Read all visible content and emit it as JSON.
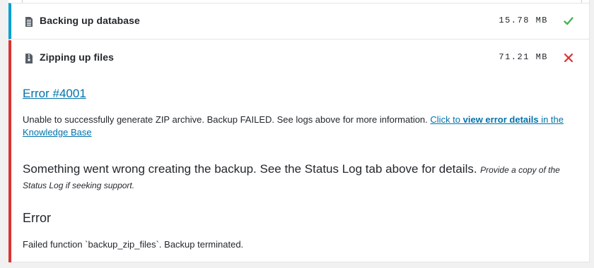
{
  "steps": [
    {
      "title": "Backing up database",
      "size": "15.78 MB",
      "status": "success",
      "icon": "database-file-icon",
      "accent_color": "#00a0d2",
      "status_color": "#46b450"
    },
    {
      "title": "Zipping up files",
      "size": "71.21 MB",
      "status": "error",
      "icon": "zip-file-icon",
      "accent_color": "#dc3232",
      "status_color": "#dc3232"
    }
  ],
  "error": {
    "code_link": "Error #4001",
    "description": "Unable to successfully generate ZIP archive. Backup FAILED. See logs above for more information.",
    "details_link_prefix": "Click to ",
    "details_link_strong": "view error details",
    "details_link_suffix": " in the Knowledge Base",
    "wrong_message": "Something went wrong creating the backup. See the Status Log tab above for details.",
    "wrong_note": "Provide a copy of the Status Log if seeking support.",
    "heading": "Error",
    "failed_function": "Failed function `backup_zip_files`. Backup terminated."
  }
}
